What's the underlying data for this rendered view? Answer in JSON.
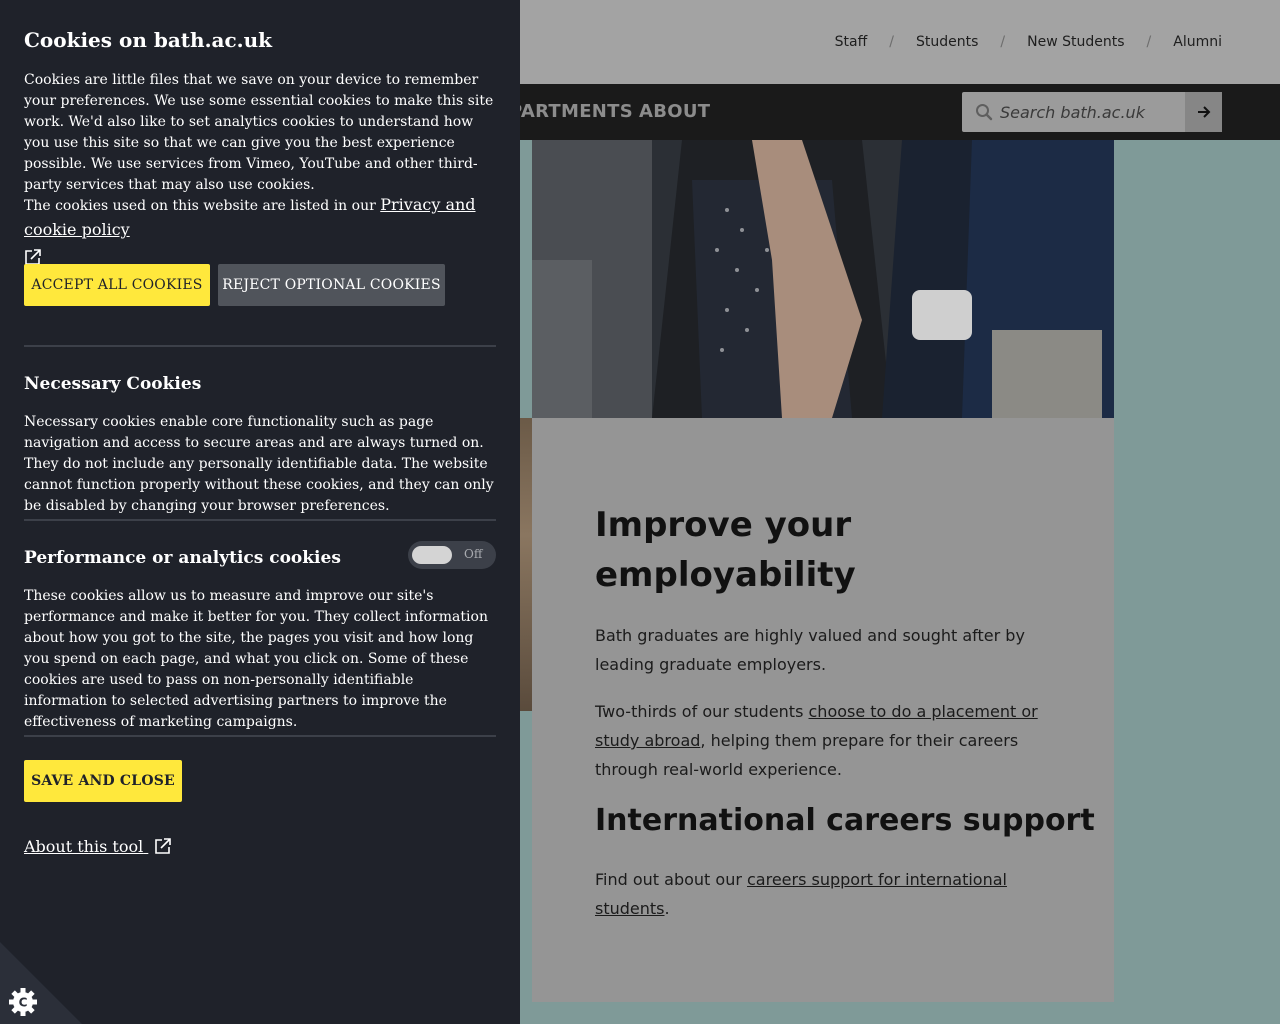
{
  "audience_nav": [
    "Staff",
    "Students",
    "New Students",
    "Alumni"
  ],
  "audience_sep": "/",
  "main_nav": [
    "PARTMENTS",
    "ABOUT"
  ],
  "search": {
    "placeholder": "Search bath.ac.uk",
    "icon": "search-icon",
    "submit_icon": "arrow-right-icon"
  },
  "content": {
    "heading1": "Improve your employability",
    "p1": "Bath graduates are highly valued and sought after by leading graduate employers.",
    "p2_before": "Two-thirds of our students ",
    "p2_link": "choose to do a placement or study abroad",
    "p2_after": ", helping them prepare for their careers through real-world experience.",
    "heading2": "International careers support",
    "p3_before": "Find out about our ",
    "p3_link": "careers support for international students",
    "p3_after": "."
  },
  "cookies": {
    "title": "Cookies on bath.ac.uk",
    "intro": "Cookies are little files that we save on your device to remember your preferences. We use some essential cookies to make this site work. We'd also like to set analytics cookies to understand how you use this site so that we can give you the best experience possible. We use services from Vimeo, YouTube and other third-party services that may also use cookies.",
    "policy_text": "The cookies used on this website are listed in our ",
    "policy_link": "Privacy and cookie policy",
    "accept_label": "ACCEPT ALL COOKIES",
    "reject_label": "REJECT OPTIONAL COOKIES",
    "necessary_title": "Necessary Cookies",
    "necessary_text": "Necessary cookies enable core functionality such as page navigation and access to secure areas and are always turned on. They do not include any personally identifiable data. The website cannot function properly without these cookies, and they can only be disabled by changing your browser preferences.",
    "performance_title": "Performance or analytics cookies",
    "performance_toggle": "Off",
    "performance_text": "These cookies allow us to measure and improve our site's performance and make it better for you. They collect information about how you got to the site, the pages you visit and how long you spend on each page, and what you click on. Some of these cookies are used to pass on non-personally identifiable information to selected advertising partners to improve the effectiveness of marketing campaigns.",
    "save_label": "SAVE AND CLOSE",
    "about_label": "About this tool"
  },
  "colors": {
    "panel_bg": "#1f222a",
    "accent_yellow": "#ffe83c",
    "secondary_button": "#50545b"
  }
}
